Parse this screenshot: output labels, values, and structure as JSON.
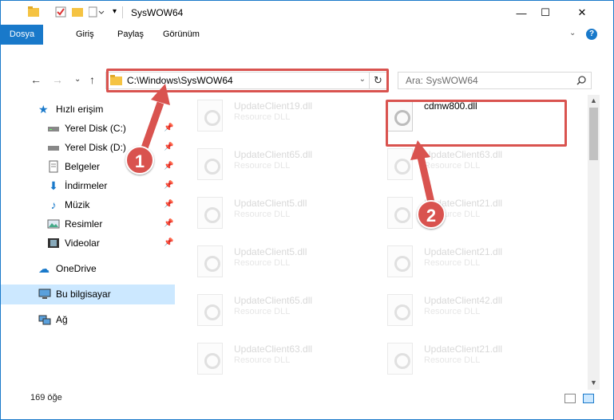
{
  "window": {
    "title": "SysWOW64",
    "controls": {
      "minimize": "—",
      "maximize": "☐",
      "close": "✕"
    }
  },
  "ribbon": {
    "tabs": [
      "Dosya",
      "Giriş",
      "Paylaş",
      "Görünüm"
    ],
    "help_icon": "?"
  },
  "address": {
    "path": "C:\\Windows\\SysWOW64",
    "refresh_icon": "↻",
    "search_placeholder": "Ara: SysWOW64"
  },
  "navigation": {
    "quick_access": "Hızlı erişim",
    "items": [
      {
        "label": "Yerel Disk (C:)",
        "pinned": true
      },
      {
        "label": "Yerel Disk (D:)",
        "pinned": true
      },
      {
        "label": "Belgeler",
        "pinned": true
      },
      {
        "label": "İndirmeler",
        "pinned": true
      },
      {
        "label": "Müzik",
        "pinned": true
      },
      {
        "label": "Resimler",
        "pinned": true
      },
      {
        "label": "Videolar",
        "pinned": true
      }
    ],
    "onedrive": "OneDrive",
    "this_pc": "Bu bilgisayar",
    "network": "Ağ"
  },
  "files": [
    {
      "name": "UpdateClient19.dll",
      "type": "Resource DLL"
    },
    {
      "name": "cdmw800.dll",
      "type": ""
    },
    {
      "name": "UpdateClient65.dll",
      "type": "Resource DLL"
    },
    {
      "name": "UpdateClient63.dll",
      "type": "Resource DLL"
    },
    {
      "name": "UpdateClient5.dll",
      "type": "Resource DLL"
    },
    {
      "name": "UpdateClient21.dll",
      "type": "Resource DLL"
    },
    {
      "name": "UpdateClient5.dll",
      "type": "Resource DLL"
    },
    {
      "name": "UpdateClient21.dll",
      "type": "Resource DLL"
    },
    {
      "name": "UpdateClient65.dll",
      "type": "Resource DLL"
    },
    {
      "name": "UpdateClient42.dll",
      "type": "Resource DLL"
    },
    {
      "name": "UpdateClient63.dll",
      "type": "Resource DLL"
    },
    {
      "name": "UpdateClient21.dll",
      "type": "Resource DLL"
    }
  ],
  "status": {
    "count": "169 öğe"
  },
  "callouts": [
    "1",
    "2"
  ],
  "colors": {
    "accent": "#1979ca",
    "highlight": "#d9534f",
    "selection": "#cce8ff"
  }
}
